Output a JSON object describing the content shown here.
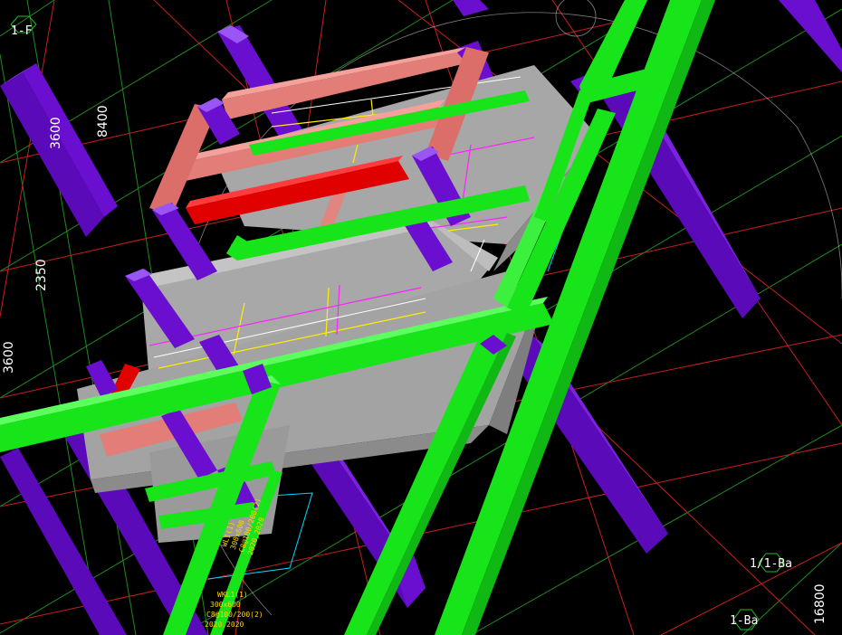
{
  "grid_labels": {
    "top_left": "1-F",
    "right_upper": "1/1-Ba",
    "right_lower": "1-Ba"
  },
  "dimensions": {
    "d1": "3600",
    "d2": "8400",
    "d3": "2350",
    "d4": "3600",
    "d5": "16800"
  },
  "annotation_upper": {
    "l1": "WL1(1)",
    "l2": "300x600",
    "l3": "C8@100/200(2)",
    "l4": "2020,2020"
  },
  "annotation_lower": {
    "l1": "WKL1(1)",
    "l2": "300x600",
    "l3": "C8@100/200(2)",
    "l4": "2020,2020"
  },
  "colors": {
    "background": "#000000",
    "column": "#6a0fd0",
    "beam_green": "#17e51a",
    "beam_pink": "#e37d78",
    "beam_red": "#e00000",
    "slab": "#a7a7a7",
    "grid_red": "#c81e1e",
    "grid_green": "#1f8a1f",
    "rebar_magenta": "#ff22ff",
    "rebar_yellow": "#ffee00",
    "annotation": "#ffd400"
  }
}
